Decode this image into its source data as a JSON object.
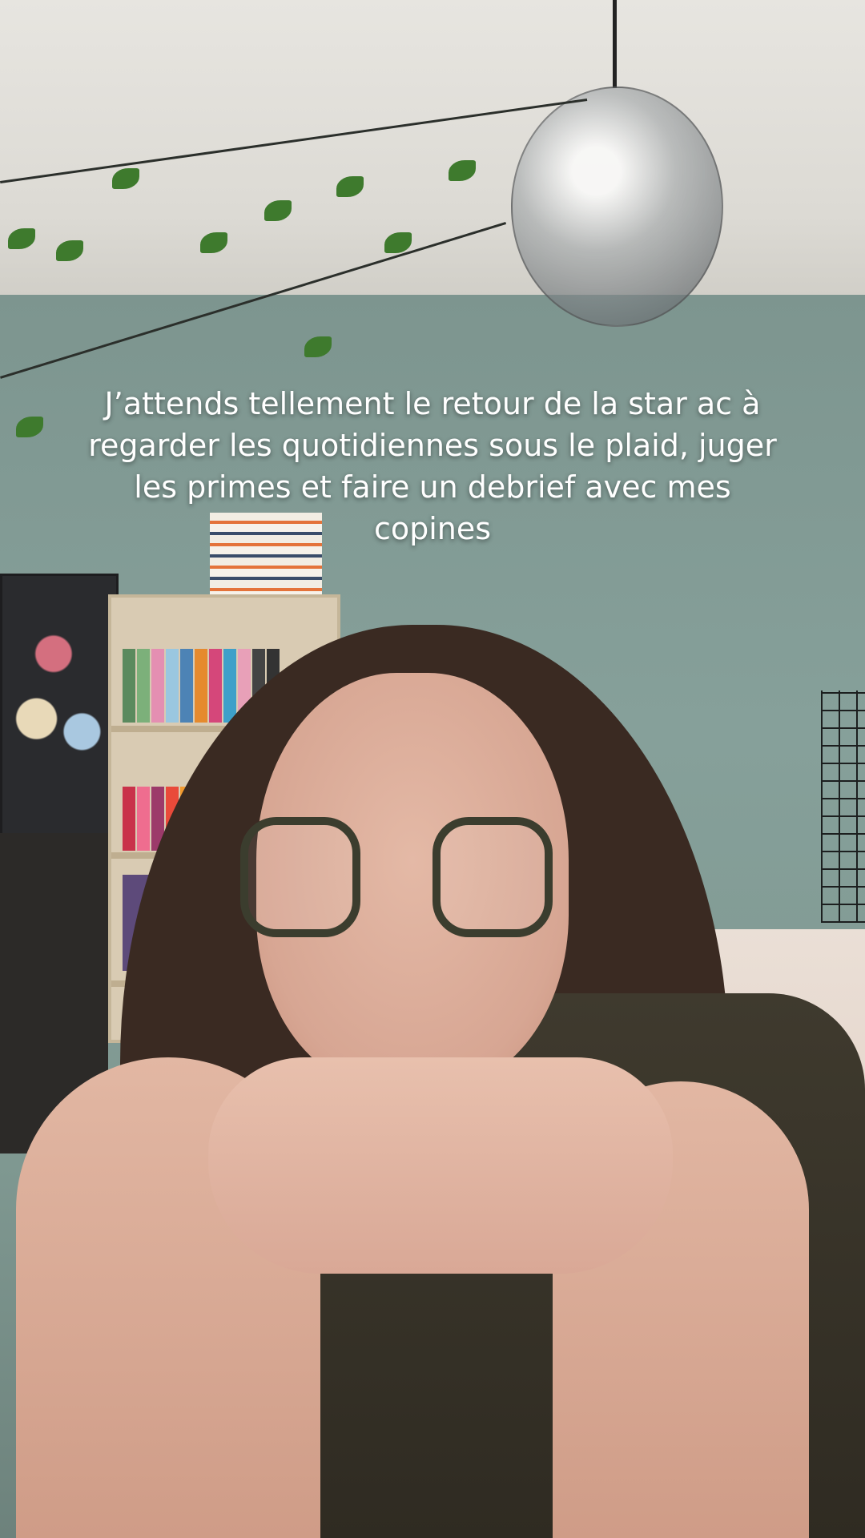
{
  "overlay": {
    "caption_lines": [
      "J’attends tellement le retour de la star ac à",
      "regarder les quotidiennes sous le plaid, juger",
      "les primes et faire un debrief avec mes",
      "copines"
    ]
  },
  "scene": {
    "wall_color": "#7d958f",
    "ceiling_color": "#e7e5e0",
    "shirt_color": "#3f3a2e"
  }
}
